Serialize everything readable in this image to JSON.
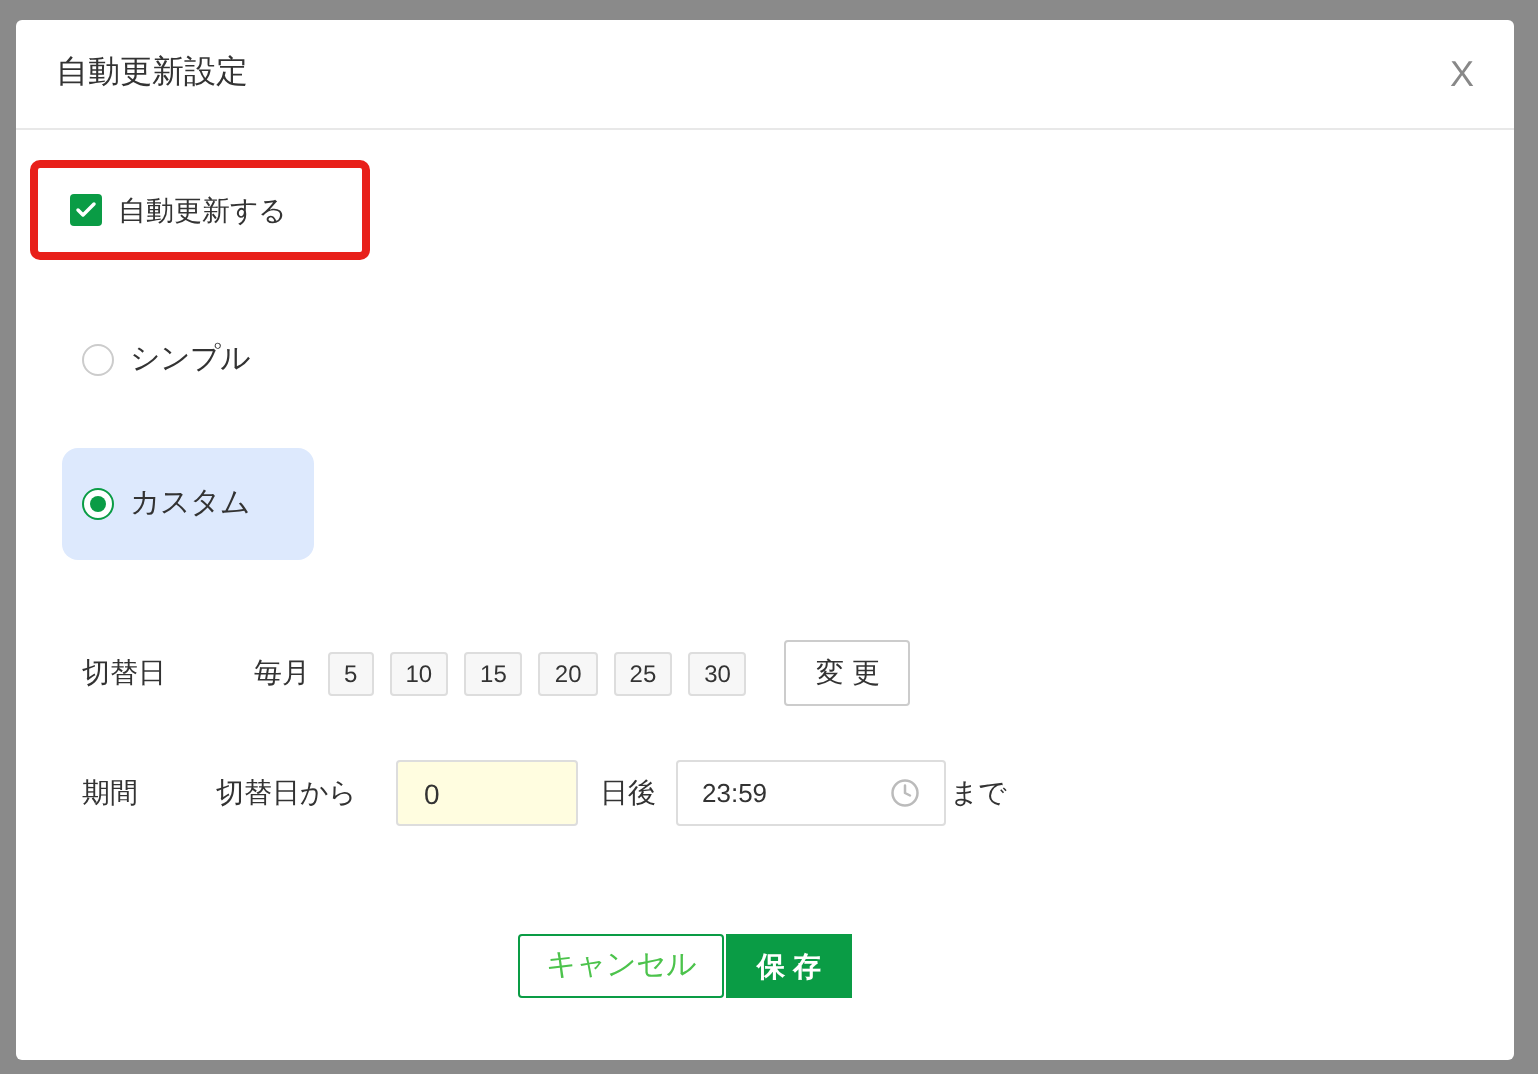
{
  "dialog": {
    "title": "自動更新設定",
    "close": "X"
  },
  "auto_update": {
    "label": "自動更新する",
    "checked": true,
    "highlighted": true
  },
  "modes": [
    {
      "label": "シンプル",
      "selected": false
    },
    {
      "label": "カスタム",
      "selected": true
    }
  ],
  "switch_day": {
    "label": "切替日",
    "prefix": "毎月",
    "days": [
      "5",
      "10",
      "15",
      "20",
      "25",
      "30"
    ],
    "button": "変 更"
  },
  "period": {
    "label": "期間",
    "prefix": "切替日から",
    "days_value": "0",
    "days_suffix": "日後",
    "time_value": "23:59",
    "suffix": "まで"
  },
  "buttons": {
    "cancel": "キャンセル",
    "save": "保 存"
  }
}
